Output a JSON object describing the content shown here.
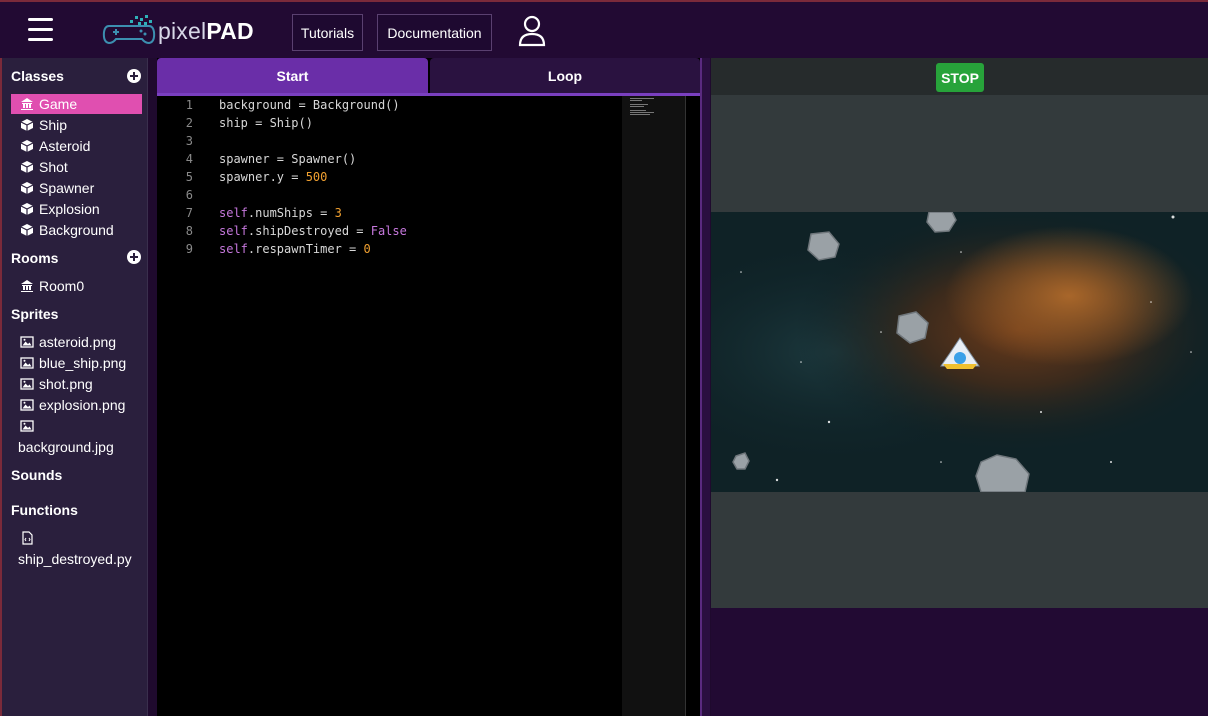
{
  "header": {
    "logo_light": "pixel",
    "logo_bold": "PAD",
    "nav": {
      "tutorials": "Tutorials",
      "documentation": "Documentation"
    }
  },
  "sidebar": {
    "classes": {
      "heading": "Classes",
      "items": [
        "Game",
        "Ship",
        "Asteroid",
        "Shot",
        "Spawner",
        "Explosion",
        "Background"
      ],
      "active": "Game"
    },
    "rooms": {
      "heading": "Rooms",
      "items": [
        "Room0"
      ]
    },
    "sprites": {
      "heading": "Sprites",
      "items": [
        "asteroid.png",
        "blue_ship.png",
        "shot.png",
        "explosion.png",
        "background.jpg"
      ]
    },
    "sounds": {
      "heading": "Sounds"
    },
    "functions": {
      "heading": "Functions",
      "items": [
        "ship_destroyed.py"
      ]
    }
  },
  "editor": {
    "tabs": {
      "start": "Start",
      "loop": "Loop"
    },
    "active_tab": "Start",
    "lines": [
      {
        "n": "1",
        "code": "background = Background()"
      },
      {
        "n": "2",
        "code": "ship = Ship()"
      },
      {
        "n": "3",
        "code": ""
      },
      {
        "n": "4",
        "code": "spawner = Spawner()"
      },
      {
        "n": "5",
        "code": "spawner.y = 500"
      },
      {
        "n": "6",
        "code": ""
      },
      {
        "n": "7",
        "code": "self.numShips = 3"
      },
      {
        "n": "8",
        "code": "self.shipDestroyed = False"
      },
      {
        "n": "9",
        "code": "self.respawnTimer = 0"
      }
    ]
  },
  "game": {
    "stop_label": "STOP"
  },
  "colors": {
    "active_item": "#e04fb0",
    "active_tab": "#6a2ea8",
    "stop_button": "#27a33a",
    "background": "#220a33"
  }
}
